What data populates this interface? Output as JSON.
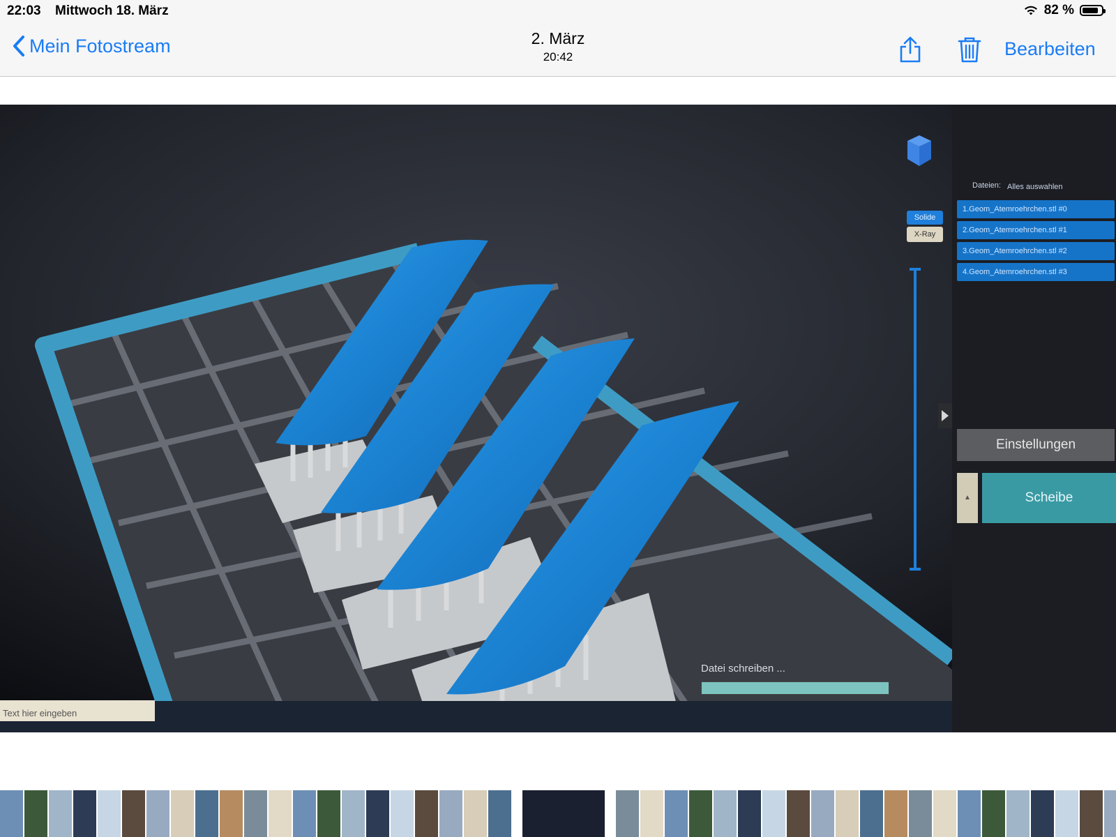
{
  "status_bar": {
    "time": "22:03",
    "date": "Mittwoch 18. März",
    "battery_percent": "82 %",
    "battery_level": 0.82,
    "icons": [
      "wifi-icon",
      "battery-icon"
    ]
  },
  "nav": {
    "back_label": "Mein Fotostream",
    "title": "2. März",
    "subtitle": "20:42",
    "edit_label": "Bearbeiten",
    "icons": [
      "chevron-left-icon",
      "share-icon",
      "trash-icon"
    ],
    "accent_color": "#1a7cf5"
  },
  "photo_content": {
    "files_label": "Dateien:",
    "select_all_label": "Alles auswahlen",
    "files": [
      "1.Geom_Atemroehrchen.stl #0",
      "2.Geom_Atemroehrchen.stl #1",
      "3.Geom_Atemroehrchen.stl #2",
      "4.Geom_Atemroehrchen.stl #3"
    ],
    "solid_label": "Solide",
    "xray_label": "X-Ray",
    "settings_label": "Einstellungen",
    "slice_label": "Scheibe",
    "progress_label": "Datei schreiben ...",
    "progress_value": 0.97,
    "taskbar_search_placeholder": "Text hier eingeben",
    "model_color": "#1e86d6",
    "platform_color": "#3e9cc4"
  },
  "filmstrip": {
    "thumb_count_before": 21,
    "thumb_count_after": 21,
    "active_index": 21
  }
}
